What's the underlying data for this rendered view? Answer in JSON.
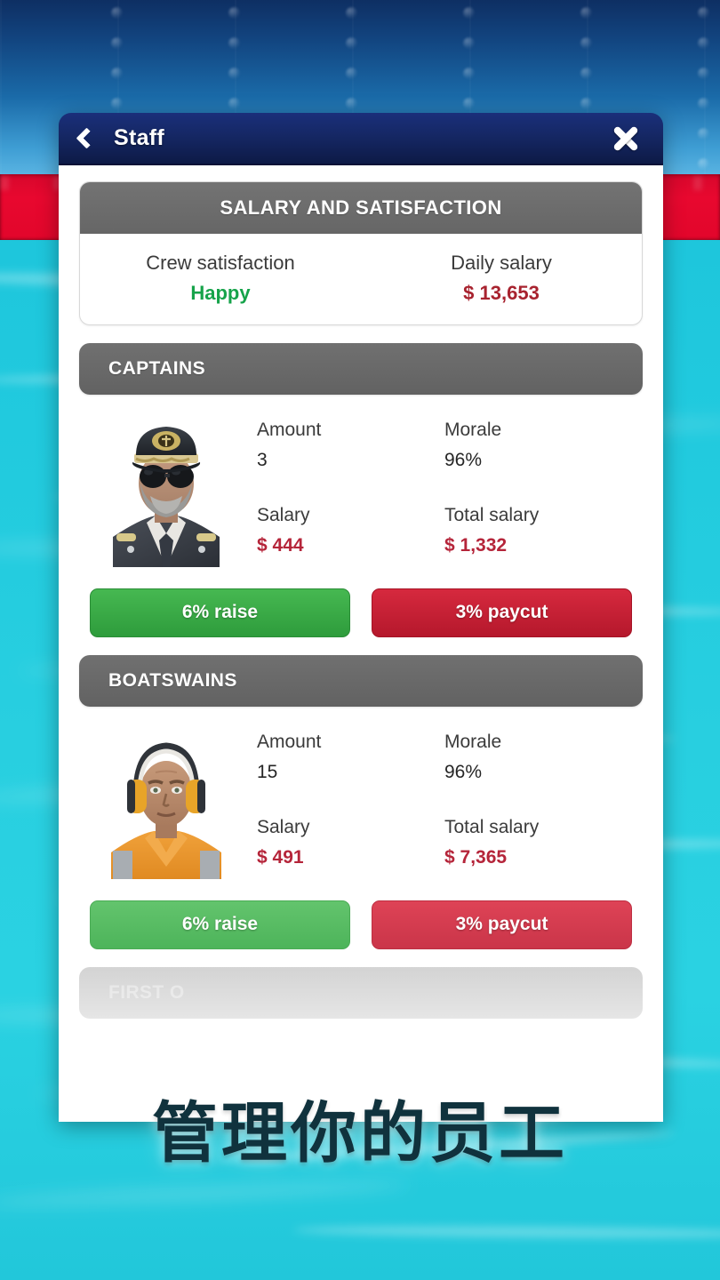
{
  "window": {
    "title": "Staff",
    "back_icon": "chevron-left-icon",
    "close_icon": "close-icon"
  },
  "summary_card": {
    "header": "SALARY AND SATISFACTION",
    "columns": [
      {
        "label": "Crew satisfaction",
        "value": "Happy",
        "value_color": "#16a34a"
      },
      {
        "label": "Daily salary",
        "value": "$ 13,653",
        "value_color": "#a8232f"
      }
    ]
  },
  "sections": [
    {
      "header": "CAPTAINS",
      "avatar": "captain-avatar",
      "stats": [
        {
          "label": "Amount",
          "value": "3"
        },
        {
          "label": "Morale",
          "value": "96%"
        },
        {
          "label": "Salary",
          "value": "$ 444"
        },
        {
          "label": "Total salary",
          "value": "$ 1,332"
        }
      ],
      "raise_label": "6% raise",
      "paycut_label": "3% paycut"
    },
    {
      "header": "BOATSWAINS",
      "avatar": "boatswain-avatar",
      "stats": [
        {
          "label": "Amount",
          "value": "15"
        },
        {
          "label": "Morale",
          "value": "96%"
        },
        {
          "label": "Salary",
          "value": "$ 491"
        },
        {
          "label": "Total salary",
          "value": "$ 7,365"
        }
      ],
      "raise_label": "6% raise",
      "paycut_label": "3% paycut"
    }
  ],
  "next_section_ghost": "FIRST O",
  "caption": "管理你的员工",
  "colors": {
    "titlebar": "#152764",
    "section_header": "#666666",
    "raise_green": "#2e9c3c",
    "paycut_red": "#b5182c",
    "money_red": "#b5253a",
    "happy_green": "#16a34a",
    "water": "#22c9dc",
    "hull_red": "#e2062b"
  }
}
